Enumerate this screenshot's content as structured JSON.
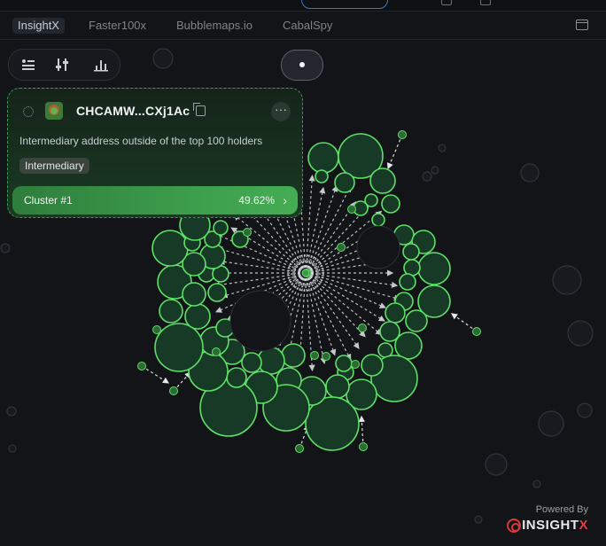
{
  "tabs": [
    {
      "label": "InsightX",
      "active": true
    },
    {
      "label": "Faster100x",
      "active": false
    },
    {
      "label": "Bubblemaps.io",
      "active": false
    },
    {
      "label": "CabalSpy",
      "active": false
    }
  ],
  "toolbar": {
    "icons": [
      "list-filter-icon",
      "sliders-icon",
      "chart-bars-icon"
    ]
  },
  "card": {
    "address": "CHCAMW...CXj1Ac",
    "description": "Intermediary address outside of the top 100 holders",
    "tag": "Intermediary",
    "cluster_label": "Cluster #1",
    "cluster_percent": "49.62%",
    "more": "···",
    "chevron": "›"
  },
  "footer": {
    "powered_by": "Powered By",
    "brand_main": "INSIGHT",
    "brand_x": "X"
  },
  "colors": {
    "accent_green": "#5ee066",
    "bubble_fill": "#173a27",
    "background": "#121417"
  }
}
